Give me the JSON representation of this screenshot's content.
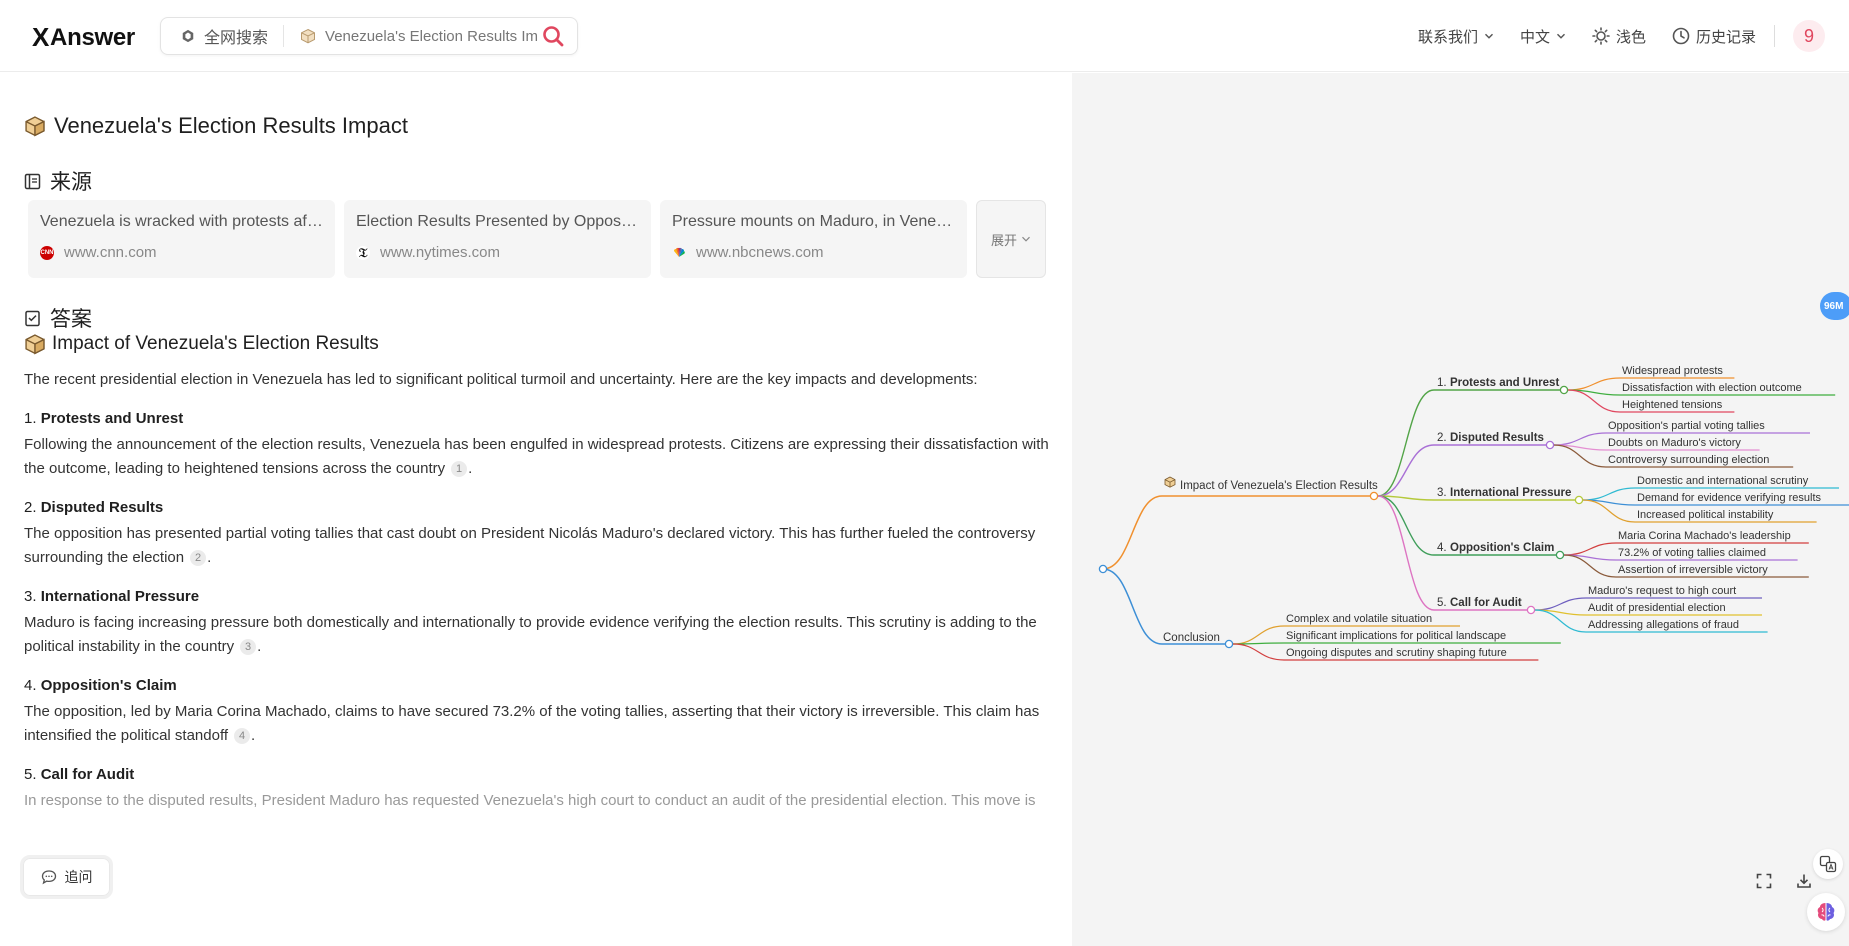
{
  "header": {
    "logo_x": "X",
    "logo_text": "Answer",
    "scope_label": "全网搜索",
    "query_value": "Venezuela's Election Results Impact",
    "contact_label": "联系我们",
    "lang_label": "中文",
    "theme_label": "浅色",
    "history_label": "历史记录",
    "avatar_text": "9"
  },
  "main": {
    "title": "Venezuela's Election Results Impact",
    "sources_heading": "来源",
    "sources": [
      {
        "title": "Venezuela is wracked with protests after disputed election",
        "site": "www.cnn.com"
      },
      {
        "title": "Election Results Presented by Opposition",
        "site": "www.nytimes.com"
      },
      {
        "title": "Pressure mounts on Maduro, in Venezuela",
        "site": "www.nbcnews.com"
      }
    ],
    "expand_label": "展开",
    "answer_heading": "答案",
    "answer_title": "Impact of Venezuela's Election Results",
    "intro": "The recent presidential election in Venezuela has led to significant political turmoil and uncertainty. Here are the key impacts and developments:",
    "items": [
      {
        "num": "1.",
        "title": "Protests and Unrest",
        "text": "Following the announcement of the election results, Venezuela has been engulfed in widespread protests. Citizens are expressing their dissatisfaction with the outcome, leading to heightened tensions across the country",
        "cite": "1"
      },
      {
        "num": "2.",
        "title": "Disputed Results",
        "text": "The opposition has presented partial voting tallies that cast doubt on President Nicolás Maduro's declared victory. This has further fueled the controversy surrounding the election",
        "cite": "2"
      },
      {
        "num": "3.",
        "title": "International Pressure",
        "text": "Maduro is facing increasing pressure both domestically and internationally to provide evidence verifying the election results. This scrutiny is adding to the political instability in the country",
        "cite": "3"
      },
      {
        "num": "4.",
        "title": "Opposition's Claim",
        "text": "The opposition, led by Maria Corina Machado, claims to have secured 73.2% of the voting tallies, asserting that their victory is irreversible. This claim has intensified the political standoff",
        "cite": "4"
      },
      {
        "num": "5.",
        "title": "Call for Audit",
        "text": "In response to the disputed results, President Maduro has requested Venezuela's high court to conduct an audit of the presidential election. This move is",
        "cite": ""
      }
    ],
    "followup_label": "追问"
  },
  "mindmap": {
    "root_label": "Impact of Venezuela's Election Results",
    "conclusion_label": "Conclusion",
    "branches": [
      {
        "num": "1.",
        "title": "Protests and Unrest",
        "color": "#52a447",
        "leaves": [
          "Widespread protests",
          "Dissatisfaction with election outcome",
          "Heightened tensions"
        ]
      },
      {
        "num": "2.",
        "title": "Disputed Results",
        "color": "#a970d6",
        "leaves": [
          "Opposition's partial voting tallies",
          "Doubts on Maduro's victory",
          "Controversy surrounding election"
        ]
      },
      {
        "num": "3.",
        "title": "International Pressure",
        "color": "#b5c93b",
        "leaves": [
          "Domestic and international scrutiny",
          "Demand for evidence verifying results",
          "Increased political instability"
        ]
      },
      {
        "num": "4.",
        "title": "Opposition's Claim",
        "color": "#3f9e5a",
        "leaves": [
          "Maria Corina Machado's leadership",
          "73.2% of voting tallies claimed",
          "Assertion of irreversible victory"
        ]
      },
      {
        "num": "5.",
        "title": "Call for Audit",
        "color": "#dd74c2",
        "leaves": [
          "Maduro's request to high court",
          "Audit of presidential election",
          "Addressing allegations of fraud"
        ]
      }
    ],
    "conclusion_leaves": [
      "Complex and volatile situation",
      "Significant implications for political landscape",
      "Ongoing disputes and scrutiny shaping future"
    ],
    "badge": "96M"
  },
  "colors": {
    "accent_red": "#e0475f",
    "root_line": "#f0902e",
    "conclusion_line": "#3d8fd6",
    "badge_blue": "#4d9df8"
  }
}
